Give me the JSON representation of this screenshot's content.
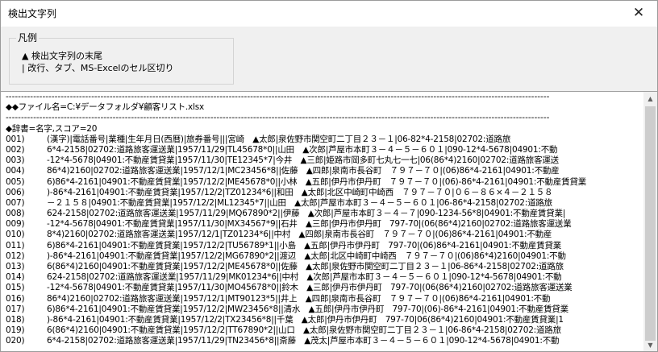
{
  "window": {
    "title": "検出文字列",
    "close_glyph": "✕"
  },
  "legend": {
    "title": "凡例",
    "line1": "▲ 検出文字列の末尾",
    "line2": "| 改行、タブ、MS-Excelのセル区切り"
  },
  "results": {
    "separator": "----------------------------------------------------------------------------------------------------------------------------------------------------------------------------------",
    "file_line": "◆◆ファイル名=C:¥データフォルダ¥顧客リスト.xlsx",
    "dict_line": "◆辞書=名字,スコア=20",
    "rows": [
      {
        "no": "001)",
        "text": "(漢字)|電話番号|業種|生年月日(西暦)|旅券番号|||宮崎　▲太郎|泉佐野市関空町二丁目２３－１|06-82*4-2158|02702:道路旅"
      },
      {
        "no": "002)",
        "text": "6*4-2158|02702:道路旅客運送業|1957/11/29|TL45678*0||山田　▲次郎|芦屋市本町３－４－５－６０１|090-12*4-5678|04901:不動"
      },
      {
        "no": "003)",
        "text": "-12*4-5678|04901:不動産賃貸業|1957/11/30|TE12345*7|今井　▲三郎|姫路市岡多町七丸七一七|06(86*4)2160|02702:道路旅客運送"
      },
      {
        "no": "004)",
        "text": "86*4)2160|02702:道路旅客運送業|1957/12/1|MC23456*8||佐藤　▲四郎|泉南市長谷町　７９７－７０|(06)86*4-2161|04901:不動産"
      },
      {
        "no": "005)",
        "text": "6)86*4-2161|04901:不動産賃貸業|1957/12/2|ME45678*0||小林　▲五郎|伊丹市伊丹町　７９７－７０|(06)-86*4-2161|04901:不動産賃貸業"
      },
      {
        "no": "006)",
        "text": ")-86*4-2161|04901:不動産賃貸業|1957/12/2|TZ01234*6||和田　▲太郎|北区中崎町中崎西　７９７－７０|０６－８６×４－２１５８"
      },
      {
        "no": "007)",
        "text": "－２１５８|04901:不動産賃貸業|1957/12/2|ML12345*7||山田　▲太郎|芦屋市本町３－４－５－６０１|06-86*4-2158|02702:道路旅"
      },
      {
        "no": "008)",
        "text": "624-2158|02702:道路旅客運送業|1957/11/29|MQ67890*2||伊藤　▲次郎|芦屋市本町３－４－７|090-1234-56*8|04901:不動産賃貸業|"
      },
      {
        "no": "009)",
        "text": "-12*4-5678|04901:不動産賃貸業|1957/11/30|MX34567*9||石井　▲三郎|伊丹市伊丹町　797-70|(06(86*4)2160|02702:道路旅客運送業"
      },
      {
        "no": "010)",
        "text": "8*4)2160|02702:道路旅客運送業|1957/12/1|TZ01234*6||中村　▲四郎|泉南市長谷町　７９７－７０|(06)86*4-2161|04901:不動産"
      },
      {
        "no": "011)",
        "text": "6)86*4-2161|04901:不動産賃貸業|1957/12/2|TU56789*1||小島　▲五郎|伊丹市伊丹町　797-70|(06)86*4-2161|04901:不動産賃貸業"
      },
      {
        "no": "012)",
        "text": ")-86*4-2161|04901:不動産賃貸業|1957/12/2|MG67890*2||渡辺　▲太郎|北区中崎町中崎西　７９７－７０|(06)86*4)2160|04901:不動"
      },
      {
        "no": "013)",
        "text": "6(86*4)2160|04901:不動産賃貸業|1957/12/2|ME45678*0||佐藤　▲太郎|泉佐野市関空町二丁目２３－１|06-86*4-2158|02702:道路旅"
      },
      {
        "no": "014)",
        "text": "624-2158|02702:道路旅客運送業|1957/11/29|MK01234*6||中村　▲次郎|芦屋市本町３－４－５－６０１|090-12*4-5678|04901:不動"
      },
      {
        "no": "015)",
        "text": "-12*4-5678|04901:不動産賃貸業|1957/11/30|MO45678*0||鈴木　▲三郎|伊丹市伊丹町　797-70|(06(86*4)2160|02702:道路旅客運送業"
      },
      {
        "no": "016)",
        "text": "86*4)2160|02702:道路旅客運送業|1957/12/1|MT90123*5||井上　▲四郎|泉南市長谷町　７９７－７０|(06)86*4-2161|04901:不動"
      },
      {
        "no": "017)",
        "text": "6)86*4-2161|04901:不動産賃貸業|1957/12/2|MW23456*8||清水　▲五郎|伊丹市伊丹町　797-70|(06)-86*4-2161|04901:不動産賃貸業"
      },
      {
        "no": "018)",
        "text": ")-86*4-2161|04901:不動産賃貸業|1957/12/2|TX23456*8||千葉　▲太郎|伊丹市伊丹町　797-70|06(86*4)2160|04901:不動産賃貸業|1"
      },
      {
        "no": "019)",
        "text": "6(86*4)2160|04901:不動産賃貸業|1957/12/2|TT67890*2||山口　▲太郎|泉佐野市関空町二丁目２３－１|06-86*4-2158|02702:道路旅"
      },
      {
        "no": "020)",
        "text": "6*4-2158|02702:道路旅客運送業|1957/11/29|TN23456*8||斎藤　▲茂太|芦屋市本町３－４－５－６０１|090-12*4-5678|04901:不動"
      }
    ]
  }
}
